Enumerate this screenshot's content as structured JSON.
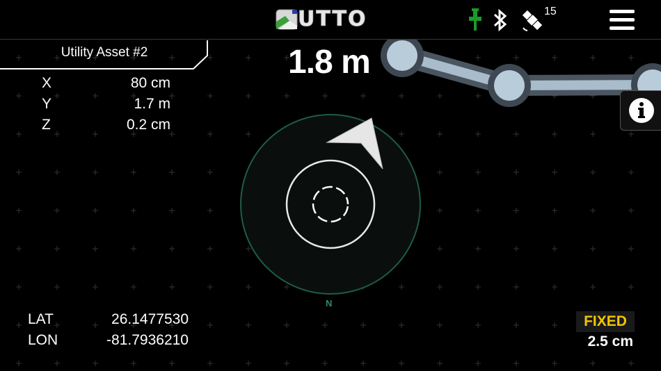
{
  "header": {
    "logo_text": "UTTO",
    "logo_icon": "utto-logo-icon",
    "status_icons": [
      "pin-icon",
      "bluetooth-icon",
      "satellite-icon"
    ],
    "satellite_count": "15",
    "menu_icon": "hamburger-menu-icon",
    "pin_color": "#1a9a2a"
  },
  "asset": {
    "title": "Utility Asset #2"
  },
  "coordinates": [
    {
      "key": "X",
      "value": "80 cm"
    },
    {
      "key": "Y",
      "value": "1.7 m"
    },
    {
      "key": "Z",
      "value": "0.2 cm"
    }
  ],
  "distance": "1.8 m",
  "compass": {
    "north_label": "N",
    "ring_color": "#1f5c47"
  },
  "location": [
    {
      "key": "LAT",
      "value": "26.1477530"
    },
    {
      "key": "LON",
      "value": "-81.7936210"
    }
  ],
  "gnss": {
    "fix_status": "FIXED",
    "fix_color": "#f2c500",
    "accuracy": "2.5 cm"
  },
  "info_button_icon": "info-icon"
}
